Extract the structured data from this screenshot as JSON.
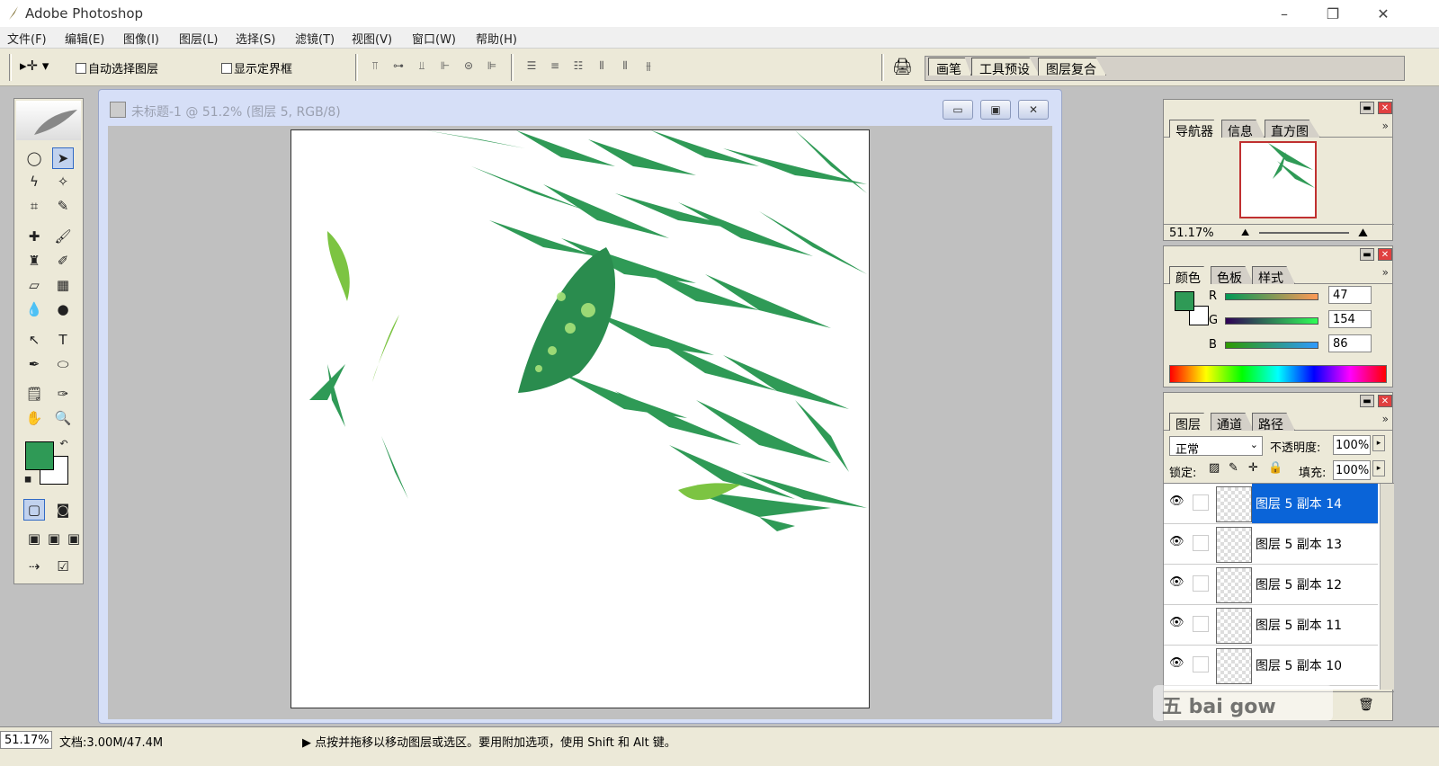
{
  "app": {
    "title": "Adobe Photoshop"
  },
  "window_controls": {
    "minimize": "–",
    "maximize": "❐",
    "close": "✕"
  },
  "menu": [
    "文件(F)",
    "编辑(E)",
    "图像(I)",
    "图层(L)",
    "选择(S)",
    "滤镜(T)",
    "视图(V)",
    "窗口(W)",
    "帮助(H)"
  ],
  "options_bar": {
    "auto_select_label": "自动选择图层",
    "show_bounds_label": "显示定界框",
    "well_tabs": [
      "画笔",
      "工具预设",
      "图层复合"
    ]
  },
  "document": {
    "title": "未标题-1 @ 51.2% (图层 5, RGB/8)"
  },
  "navigator": {
    "tabs": [
      "导航器",
      "信息",
      "直方图"
    ],
    "zoom": "51.17%"
  },
  "color_panel": {
    "tabs": [
      "颜色",
      "色板",
      "样式"
    ],
    "labels": [
      "R",
      "G",
      "B"
    ],
    "values": [
      "47",
      "154",
      "86"
    ],
    "fg_color": "#2f9a56"
  },
  "layers_panel": {
    "tabs": [
      "图层",
      "通道",
      "路径"
    ],
    "blend_mode": "正常",
    "opacity_label": "不透明度:",
    "opacity": "100%",
    "lock_label": "锁定:",
    "fill_label": "填充:",
    "fill": "100%",
    "layers": [
      {
        "name": "图层 5 副本 14",
        "selected": true
      },
      {
        "name": "图层 5 副本 13",
        "selected": false
      },
      {
        "name": "图层 5 副本 12",
        "selected": false
      },
      {
        "name": "图层 5 副本 11",
        "selected": false
      },
      {
        "name": "图层 5 副本 10",
        "selected": false
      }
    ]
  },
  "status": {
    "zoom": "51.17%",
    "doc": "文档:3.00M/47.4M",
    "hint": "▶  点按并拖移以移动图层或选区。要用附加选项，使用 Shift 和 Alt 键。"
  },
  "watermark": {
    "text": "五 bai gow"
  }
}
